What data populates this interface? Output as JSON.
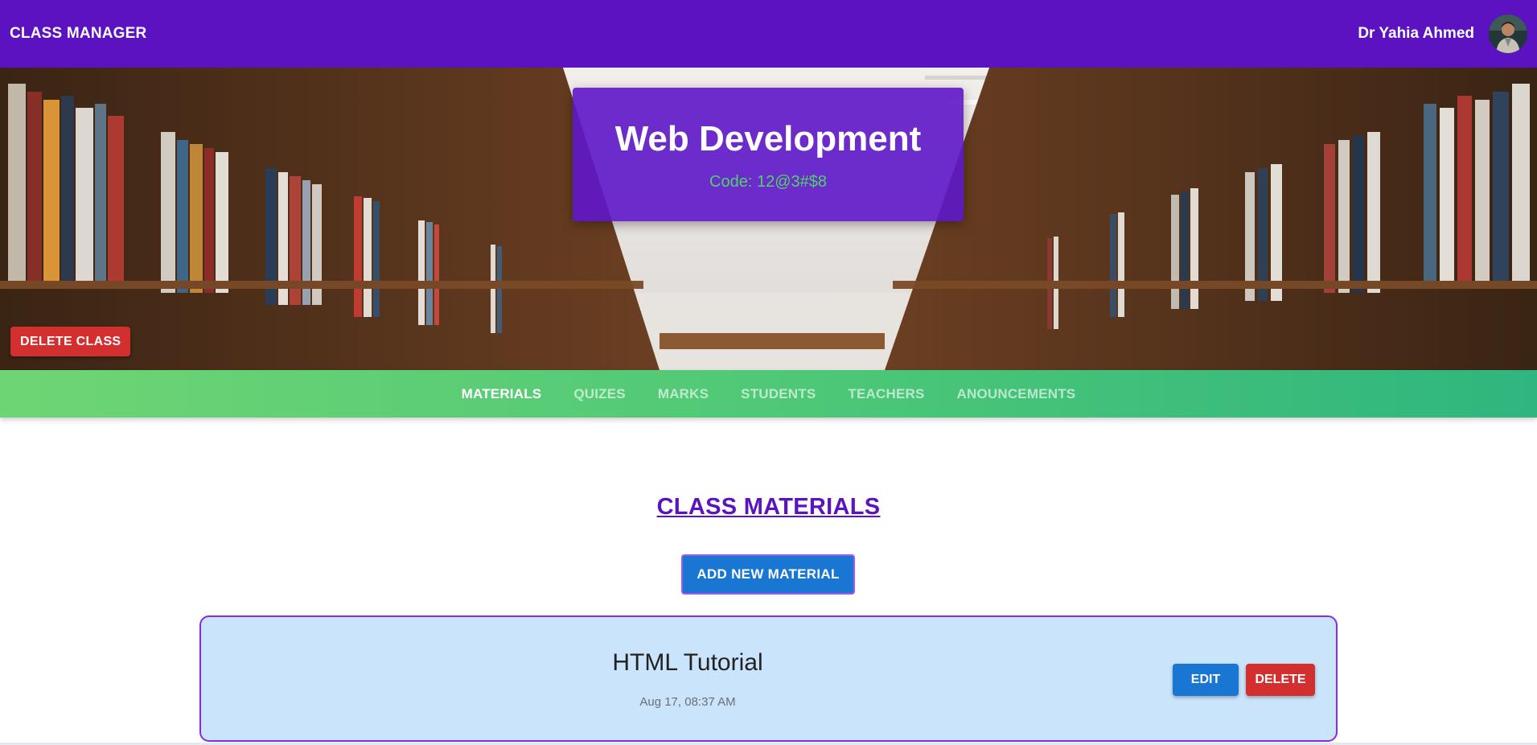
{
  "appbar": {
    "brand": "CLASS MANAGER",
    "user_name": "Dr Yahia Ahmed",
    "avatar_icon": "user-avatar-photo",
    "color": "#5b13c2"
  },
  "hero": {
    "title": "Web Development",
    "code": "Code: 12@3#$8",
    "delete_class_label": "DELETE CLASS",
    "background": "library-bookshelves-photo"
  },
  "tabs": [
    {
      "label": "MATERIALS",
      "active": true
    },
    {
      "label": "QUIZES",
      "active": false
    },
    {
      "label": "MARKS",
      "active": false
    },
    {
      "label": "STUDENTS",
      "active": false
    },
    {
      "label": "TEACHERS",
      "active": false
    },
    {
      "label": "ANOUNCEMENTS",
      "active": false
    }
  ],
  "content": {
    "section_title": "CLASS MATERIALS",
    "add_button_label": "ADD NEW MATERIAL",
    "materials": [
      {
        "title": "HTML Tutorial",
        "date": "Aug 17, 08:37 AM",
        "edit_label": "EDIT",
        "delete_label": "DELETE"
      }
    ]
  },
  "colors": {
    "primary": "#5b13c2",
    "success": "#4cc777",
    "danger": "#d32f2f",
    "info": "#1976d2",
    "code_text": "#51d16b"
  }
}
